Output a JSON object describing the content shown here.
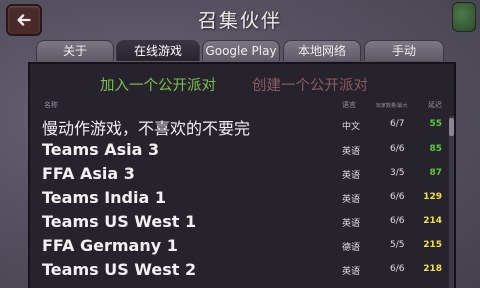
{
  "header": {
    "title": "召集伙伴"
  },
  "tabs": [
    {
      "label": "关于"
    },
    {
      "label": "在线游戏"
    },
    {
      "label": "Google Play"
    },
    {
      "label": "本地网络"
    },
    {
      "label": "手动"
    }
  ],
  "party": {
    "join_label": "加入一个公开派对",
    "create_label": "创建一个公开派对"
  },
  "columns": {
    "name": "名称",
    "language": "语言",
    "players": "玩家数量/最大",
    "ping": "延迟"
  },
  "colors": {
    "ping_green": "#5cc93a",
    "ping_yellow": "#f0e040",
    "join_green": "#7fbf4f",
    "create_red": "#8d5b60"
  },
  "rows": [
    {
      "name": "慢动作游戏，不喜欢的不要完",
      "language": "中文",
      "players": "6/7",
      "ping": "55",
      "ping_color": "#5cc93a"
    },
    {
      "name": "Teams Asia 3",
      "language": "英语",
      "players": "6/6",
      "ping": "85",
      "ping_color": "#5cc93a"
    },
    {
      "name": "FFA Asia 3",
      "language": "英语",
      "players": "3/5",
      "ping": "87",
      "ping_color": "#5cc93a"
    },
    {
      "name": "Teams India 1",
      "language": "英语",
      "players": "6/6",
      "ping": "129",
      "ping_color": "#f0e040"
    },
    {
      "name": "Teams US West 1",
      "language": "英语",
      "players": "6/6",
      "ping": "214",
      "ping_color": "#f0e040"
    },
    {
      "name": "FFA Germany 1",
      "language": "德语",
      "players": "5/5",
      "ping": "215",
      "ping_color": "#f0e040"
    },
    {
      "name": "Teams US West 2",
      "language": "英语",
      "players": "6/6",
      "ping": "218",
      "ping_color": "#f0e040"
    }
  ]
}
